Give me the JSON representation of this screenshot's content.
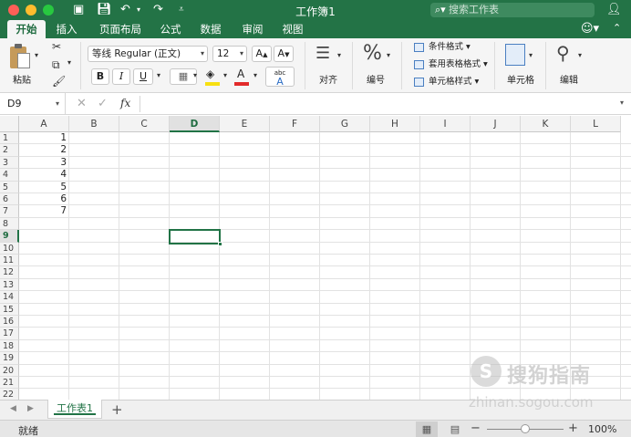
{
  "window": {
    "title": "工作簿1",
    "search_placeholder": "搜索工作表"
  },
  "tabs": [
    "开始",
    "插入",
    "页面布局",
    "公式",
    "数据",
    "审阅",
    "视图"
  ],
  "ribbon": {
    "paste_label": "粘贴",
    "font_name": "等线 Regular (正文)",
    "font_size": "12",
    "bold": "B",
    "italic": "I",
    "underline": "U",
    "font_grow": "A",
    "font_shrink": "A",
    "font_color_letter": "A",
    "phonetic_top": "abc",
    "phonetic_letter": "A",
    "align_label": "对齐",
    "number_label": "编号",
    "number_symbol": "%",
    "conditional_format": "条件格式",
    "table_format": "套用表格格式",
    "cell_styles": "单元格样式",
    "cells_label": "单元格",
    "edit_label": "编辑",
    "fill_color": "#f7e011",
    "font_color": "#e22a2a"
  },
  "formula_bar": {
    "name_box": "D9",
    "fx": "fx",
    "content": ""
  },
  "columns": [
    "A",
    "B",
    "C",
    "D",
    "E",
    "F",
    "G",
    "H",
    "I",
    "J",
    "K",
    "L"
  ],
  "selected_column": "D",
  "rows": [
    "1",
    "2",
    "3",
    "4",
    "5",
    "6",
    "7",
    "8",
    "9",
    "10",
    "11",
    "12",
    "13",
    "14",
    "15",
    "16",
    "17",
    "18",
    "19",
    "20",
    "21",
    "22"
  ],
  "selected_row": "9",
  "cells": {
    "A": [
      "1",
      "2",
      "3",
      "4",
      "5",
      "6",
      "7"
    ]
  },
  "sheets": {
    "active": "工作表1",
    "add": "+"
  },
  "status": {
    "ready": "就绪",
    "zoom": "100%",
    "zoom_minus": "−",
    "zoom_plus": "+"
  },
  "watermark": {
    "main": "搜狗指南",
    "sub": "zhinan.sogou.com",
    "logo": "S"
  },
  "colors": {
    "brand_green": "#237346",
    "selection_green": "#217346"
  }
}
